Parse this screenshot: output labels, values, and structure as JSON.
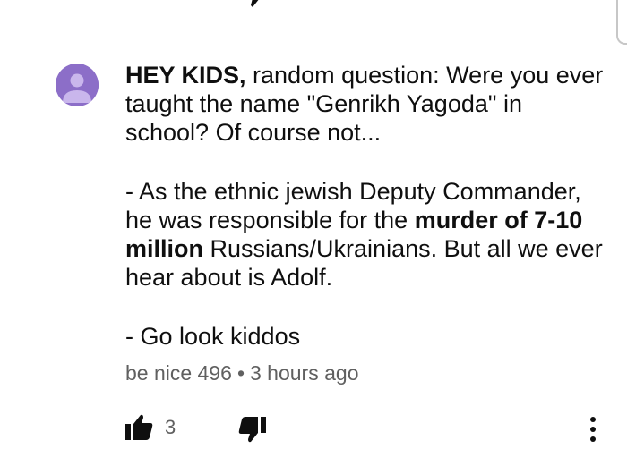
{
  "comment": {
    "author_highlight": "HEY KIDS,",
    "line1_rest": " random question: Were you ever taught the name \"Genrikh Yagoda\" in school?  Of course not...",
    "para2_start": "- As the ethnic jewish Deputy Commander, he was responsible for the ",
    "para2_bold": "murder of 7-10 million",
    "para2_end": " Russians/Ukrainians. But all we ever hear about is Adolf.",
    "para3": "- Go look kiddos"
  },
  "meta": {
    "author": "be nice 496",
    "separator": "•",
    "time": "3 hours ago"
  },
  "actions": {
    "like_count": "3"
  },
  "icons": {
    "avatar": "default-avatar-icon",
    "like": "thumbs-up-icon",
    "dislike": "thumbs-down-icon",
    "more": "more-vert-icon"
  },
  "colors": {
    "avatar_bg": "#8c6ec8",
    "avatar_fg": "#c9b6ec",
    "meta_text": "#606060",
    "icon": "#0f0f0f"
  }
}
